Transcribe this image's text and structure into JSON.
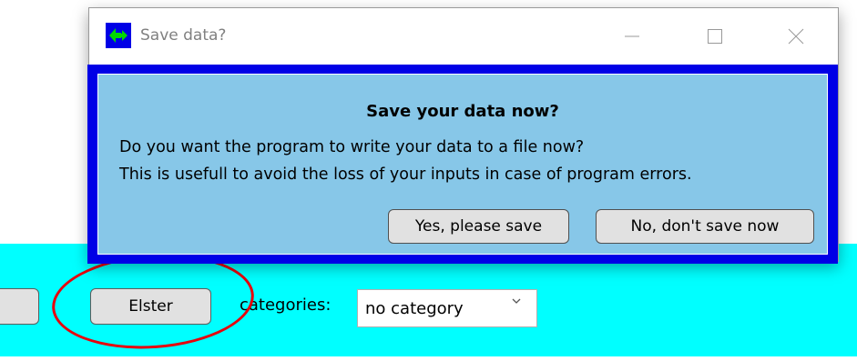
{
  "app": {
    "elster_button_label": "Elster",
    "categories_label": "categories:",
    "category_select": {
      "value": "no category"
    }
  },
  "dialog": {
    "title": "Save data?",
    "heading": "Save your data now?",
    "message_line1": "Do you want the program to write your data to a file now?",
    "message_line2": "This is usefull to avoid the loss of your inputs in case of program errors.",
    "yes_label": "Yes, please save",
    "no_label": "No, don't save now",
    "app_icon": "app-icon",
    "controls": [
      "minimize-icon",
      "maximize-icon",
      "close-icon"
    ]
  },
  "colors": {
    "app_background": "#00ffff",
    "dialog_border": "#0000e6",
    "panel": "#87c7e8",
    "annotation": "#e8000b"
  }
}
